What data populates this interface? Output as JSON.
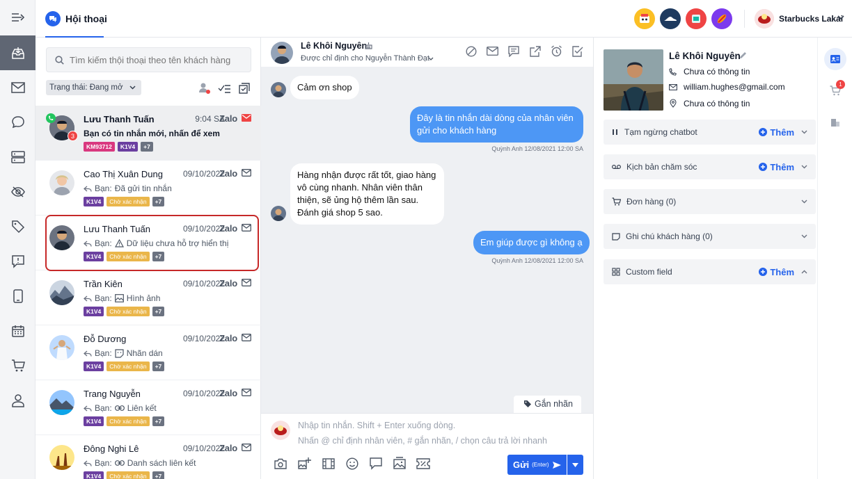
{
  "header": {
    "tab_label": "Hội thoại",
    "account_name": "Starbucks Lakai"
  },
  "search": {
    "placeholder": "Tìm kiếm thội thoại theo tên khách hàng"
  },
  "filter": {
    "status_label": "Trạng thái: Đang mở"
  },
  "conversations": [
    {
      "name": "Lưu Thanh Tuấn",
      "time": "9:04 SA",
      "channel": "Zalo",
      "preview": "Bạn có tin nhắn mới, nhấn để xem",
      "tags": [
        "KM93712",
        "K1V4",
        "+7"
      ],
      "unread": "3"
    },
    {
      "name": "Cao Thị Xuân Dung",
      "time": "09/10/2022",
      "channel": "Zalo",
      "prefix": "Bạn:",
      "preview": "Đã gửi tin nhắn",
      "tags": [
        "K1V4",
        "Chờ xác nhận",
        "+7"
      ]
    },
    {
      "name": "Lưu Thanh Tuấn",
      "time": "09/10/2022",
      "channel": "Zalo",
      "prefix": "Bạn:",
      "preview": "Dữ liệu chưa hỗ trợ hiển thị",
      "tags": [
        "K1V4",
        "Chờ xác nhận",
        "+7"
      ]
    },
    {
      "name": "Trần Kiên",
      "time": "09/10/2022",
      "channel": "Zalo",
      "prefix": "Bạn:",
      "preview": "Hình ảnh",
      "tags": [
        "K1V4",
        "Chờ xác nhận",
        "+7"
      ]
    },
    {
      "name": "Đỗ Dương",
      "time": "09/10/2022",
      "channel": "Zalo",
      "prefix": "Bạn:",
      "preview": "Nhãn dán",
      "tags": [
        "K1V4",
        "Chờ xác nhận",
        "+7"
      ]
    },
    {
      "name": "Trang Nguyễn",
      "time": "09/10/2022",
      "channel": "Zalo",
      "prefix": "Bạn:",
      "preview": "Liên kết",
      "tags": [
        "K1V4",
        "Chờ xác nhận",
        "+7"
      ]
    },
    {
      "name": "Đông Nghi Lê",
      "time": "09/10/2022",
      "channel": "Zalo",
      "prefix": "Bạn:",
      "preview": "Danh sách liên kết",
      "tags": [
        "K1V4",
        "Chờ xác nhận",
        "+7"
      ]
    }
  ],
  "chat": {
    "contact_name": "Lê Khôi Nguyên",
    "assigned": "Được chỉ định cho Nguyễn Thành Đạt",
    "messages": [
      {
        "dir": "in",
        "text": "Cảm ơn shop"
      },
      {
        "dir": "out",
        "text": "Đây là tin nhắn dài dòng của nhân viên gửi cho khách hàng",
        "meta": "Quỳnh Anh 12/08/2021 12:00 SA"
      },
      {
        "dir": "in",
        "text": "Hàng nhận được rất tốt, giao hàng vô cùng nhanh. Nhân viên thân thiện, sẽ ủng hộ thêm lần sau. Đánh giá shop 5 sao."
      },
      {
        "dir": "out",
        "text": "Em giúp được gì không ạ",
        "meta": "Quỳnh Anh 12/08/2021 12:00 SA"
      }
    ],
    "label_button": "Gắn nhãn",
    "composer_placeholder_1": "Nhập tin nhắn. Shift + Enter xuống dòng.",
    "composer_placeholder_2": "Nhấn @ chỉ định nhân viên, # gắn nhãn, / chọn câu trả lời nhanh",
    "send_label": "Gửi",
    "send_hint": "(Enter)"
  },
  "profile": {
    "name": "Lê Khôi Nguyên",
    "phone": "Chưa có thông tin",
    "email": "william.hughes@gmail.com",
    "address": "Chưa có thông tin",
    "cart_badge": "1",
    "sections": [
      {
        "label": "Tạm ngừng chatbot",
        "action": "Thêm",
        "icon": "pause-icon"
      },
      {
        "label": "Kịch bản chăm sóc",
        "action": "Thêm",
        "icon": "voicemail-icon"
      },
      {
        "label": "Đơn hàng (0)",
        "action": "",
        "icon": "cart-icon"
      },
      {
        "label": "Ghi chú khách hàng (0)",
        "action": "",
        "icon": "note-icon"
      },
      {
        "label": "Custom field",
        "action": "Thêm",
        "icon": "grid-icon"
      }
    ]
  },
  "colors": {
    "accent": "#2563eb",
    "outgoing": "#4d97f5",
    "highlight": "#c62828"
  }
}
